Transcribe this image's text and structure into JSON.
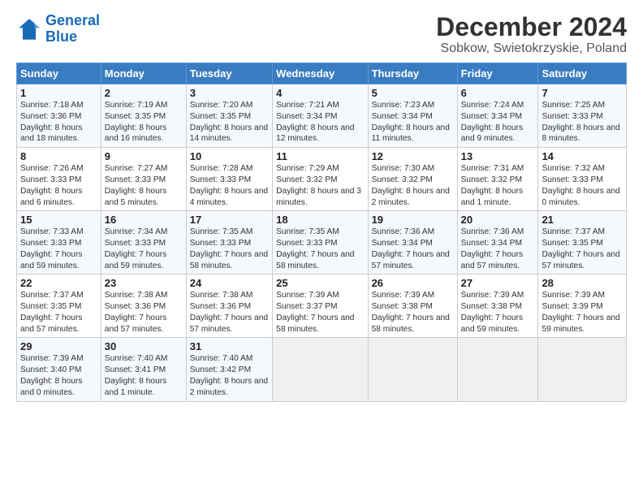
{
  "header": {
    "logo_line1": "General",
    "logo_line2": "Blue",
    "title": "December 2024",
    "subtitle": "Sobkow, Swietokrzyskie, Poland"
  },
  "weekdays": [
    "Sunday",
    "Monday",
    "Tuesday",
    "Wednesday",
    "Thursday",
    "Friday",
    "Saturday"
  ],
  "weeks": [
    [
      {
        "day": "1",
        "info": "Sunrise: 7:18 AM\nSunset: 3:36 PM\nDaylight: 8 hours and 18 minutes."
      },
      {
        "day": "2",
        "info": "Sunrise: 7:19 AM\nSunset: 3:35 PM\nDaylight: 8 hours and 16 minutes."
      },
      {
        "day": "3",
        "info": "Sunrise: 7:20 AM\nSunset: 3:35 PM\nDaylight: 8 hours and 14 minutes."
      },
      {
        "day": "4",
        "info": "Sunrise: 7:21 AM\nSunset: 3:34 PM\nDaylight: 8 hours and 12 minutes."
      },
      {
        "day": "5",
        "info": "Sunrise: 7:23 AM\nSunset: 3:34 PM\nDaylight: 8 hours and 11 minutes."
      },
      {
        "day": "6",
        "info": "Sunrise: 7:24 AM\nSunset: 3:34 PM\nDaylight: 8 hours and 9 minutes."
      },
      {
        "day": "7",
        "info": "Sunrise: 7:25 AM\nSunset: 3:33 PM\nDaylight: 8 hours and 8 minutes."
      }
    ],
    [
      {
        "day": "8",
        "info": "Sunrise: 7:26 AM\nSunset: 3:33 PM\nDaylight: 8 hours and 6 minutes."
      },
      {
        "day": "9",
        "info": "Sunrise: 7:27 AM\nSunset: 3:33 PM\nDaylight: 8 hours and 5 minutes."
      },
      {
        "day": "10",
        "info": "Sunrise: 7:28 AM\nSunset: 3:33 PM\nDaylight: 8 hours and 4 minutes."
      },
      {
        "day": "11",
        "info": "Sunrise: 7:29 AM\nSunset: 3:32 PM\nDaylight: 8 hours and 3 minutes."
      },
      {
        "day": "12",
        "info": "Sunrise: 7:30 AM\nSunset: 3:32 PM\nDaylight: 8 hours and 2 minutes."
      },
      {
        "day": "13",
        "info": "Sunrise: 7:31 AM\nSunset: 3:32 PM\nDaylight: 8 hours and 1 minute."
      },
      {
        "day": "14",
        "info": "Sunrise: 7:32 AM\nSunset: 3:33 PM\nDaylight: 8 hours and 0 minutes."
      }
    ],
    [
      {
        "day": "15",
        "info": "Sunrise: 7:33 AM\nSunset: 3:33 PM\nDaylight: 7 hours and 59 minutes."
      },
      {
        "day": "16",
        "info": "Sunrise: 7:34 AM\nSunset: 3:33 PM\nDaylight: 7 hours and 59 minutes."
      },
      {
        "day": "17",
        "info": "Sunrise: 7:35 AM\nSunset: 3:33 PM\nDaylight: 7 hours and 58 minutes."
      },
      {
        "day": "18",
        "info": "Sunrise: 7:35 AM\nSunset: 3:33 PM\nDaylight: 7 hours and 58 minutes."
      },
      {
        "day": "19",
        "info": "Sunrise: 7:36 AM\nSunset: 3:34 PM\nDaylight: 7 hours and 57 minutes."
      },
      {
        "day": "20",
        "info": "Sunrise: 7:36 AM\nSunset: 3:34 PM\nDaylight: 7 hours and 57 minutes."
      },
      {
        "day": "21",
        "info": "Sunrise: 7:37 AM\nSunset: 3:35 PM\nDaylight: 7 hours and 57 minutes."
      }
    ],
    [
      {
        "day": "22",
        "info": "Sunrise: 7:37 AM\nSunset: 3:35 PM\nDaylight: 7 hours and 57 minutes."
      },
      {
        "day": "23",
        "info": "Sunrise: 7:38 AM\nSunset: 3:36 PM\nDaylight: 7 hours and 57 minutes."
      },
      {
        "day": "24",
        "info": "Sunrise: 7:38 AM\nSunset: 3:36 PM\nDaylight: 7 hours and 57 minutes."
      },
      {
        "day": "25",
        "info": "Sunrise: 7:39 AM\nSunset: 3:37 PM\nDaylight: 7 hours and 58 minutes."
      },
      {
        "day": "26",
        "info": "Sunrise: 7:39 AM\nSunset: 3:38 PM\nDaylight: 7 hours and 58 minutes."
      },
      {
        "day": "27",
        "info": "Sunrise: 7:39 AM\nSunset: 3:38 PM\nDaylight: 7 hours and 59 minutes."
      },
      {
        "day": "28",
        "info": "Sunrise: 7:39 AM\nSunset: 3:39 PM\nDaylight: 7 hours and 59 minutes."
      }
    ],
    [
      {
        "day": "29",
        "info": "Sunrise: 7:39 AM\nSunset: 3:40 PM\nDaylight: 8 hours and 0 minutes."
      },
      {
        "day": "30",
        "info": "Sunrise: 7:40 AM\nSunset: 3:41 PM\nDaylight: 8 hours and 1 minute."
      },
      {
        "day": "31",
        "info": "Sunrise: 7:40 AM\nSunset: 3:42 PM\nDaylight: 8 hours and 2 minutes."
      },
      {
        "day": "",
        "info": ""
      },
      {
        "day": "",
        "info": ""
      },
      {
        "day": "",
        "info": ""
      },
      {
        "day": "",
        "info": ""
      }
    ]
  ]
}
